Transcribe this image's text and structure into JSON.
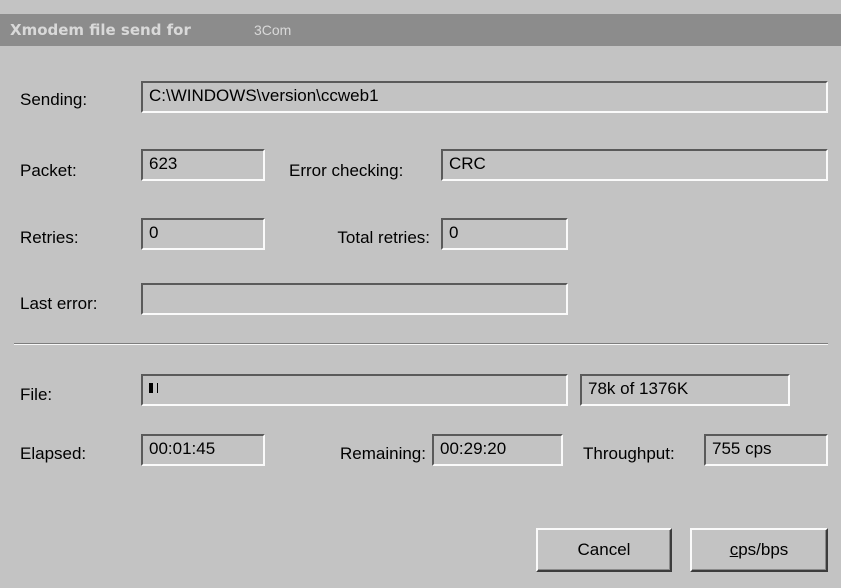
{
  "window": {
    "title": "Xmodem file send for",
    "title_suffix": "3Com"
  },
  "sending": {
    "label": "Sending:",
    "value": "C:\\WINDOWS\\version\\ccweb1"
  },
  "packet": {
    "label": "Packet:",
    "value": "623"
  },
  "error_checking": {
    "label": "Error checking:",
    "value": "CRC"
  },
  "retries": {
    "label": "Retries:",
    "value": "0"
  },
  "total_retries": {
    "label": "Total retries:",
    "value": "0"
  },
  "last_error": {
    "label": "Last error:",
    "value": ""
  },
  "file": {
    "label": "File:",
    "progress_fraction": 0.057,
    "status": "78k of 1376K"
  },
  "elapsed": {
    "label": "Elapsed:",
    "value": "00:01:45"
  },
  "remaining": {
    "label": "Remaining:",
    "value": "00:29:20"
  },
  "throughput": {
    "label": "Throughput:",
    "value": "755 cps"
  },
  "buttons": {
    "cancel": "Cancel",
    "cps_bps_underlined": "c",
    "cps_bps_rest": "ps/bps"
  }
}
